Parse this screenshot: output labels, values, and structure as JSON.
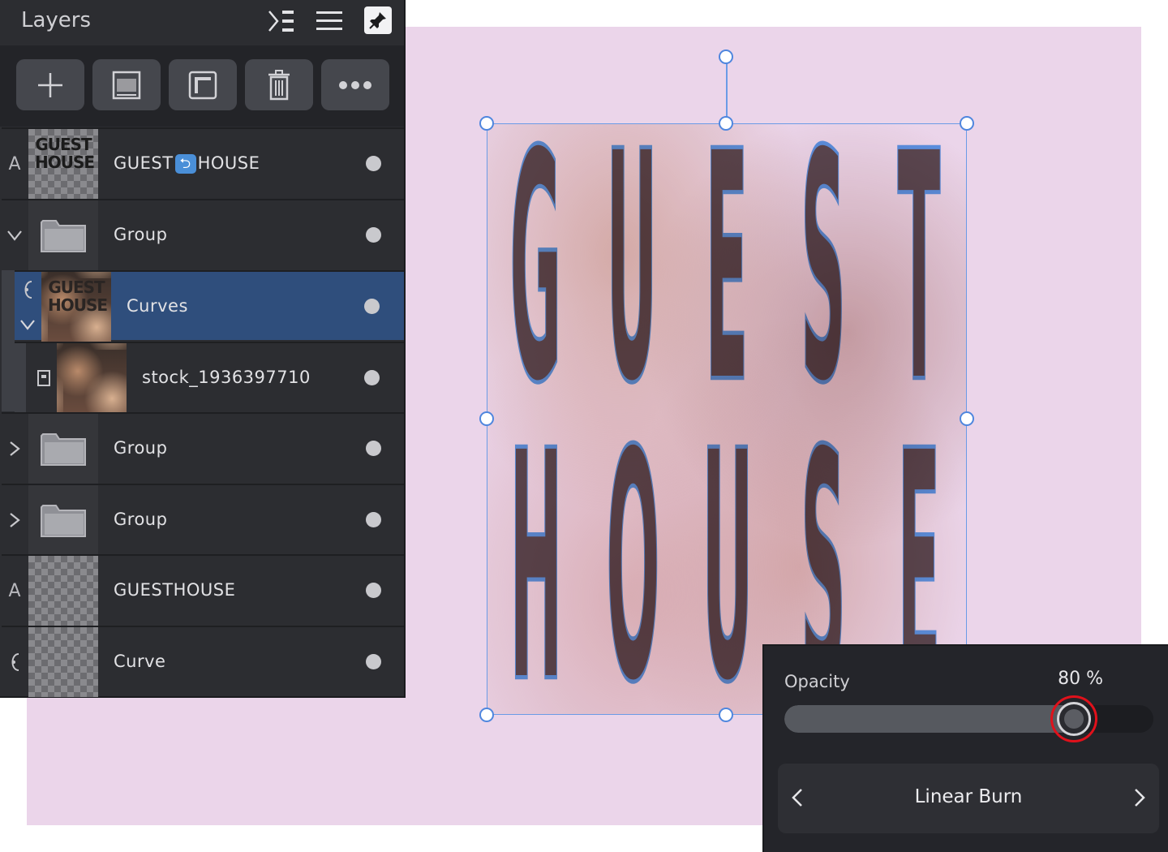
{
  "panel": {
    "title": "Layers"
  },
  "layers": [
    {
      "tag": "A",
      "label_a": "GUEST",
      "label_b": "HOUSE",
      "thumb_text": "GUEST HOUSE",
      "link_glyph": "⮌"
    },
    {
      "tag": "⌄",
      "label": "Group"
    },
    {
      "tag": "⌇",
      "tag2": "⌄",
      "label": "Curves",
      "thumb_text": "GUEST HOUSE"
    },
    {
      "label": "stock_1936397710"
    },
    {
      "tag": "›",
      "label": "Group"
    },
    {
      "tag": "›",
      "label": "Group"
    },
    {
      "tag": "A",
      "label": "GUESTHOUSE"
    },
    {
      "tag": "⌇",
      "label": "Curve"
    }
  ],
  "artwork": {
    "line1": [
      "G",
      "U",
      "E",
      "S",
      "T"
    ],
    "line2": [
      "H",
      "O",
      "U",
      "S",
      "E"
    ]
  },
  "opacity": {
    "label": "Opacity",
    "value_text": "80 %",
    "value": 80
  },
  "blend_mode": {
    "label": "Linear Burn",
    "prev_glyph": "‹",
    "next_glyph": "›"
  },
  "colors": {
    "canvas_bg": "#ebd5ea",
    "panel_bg": "#2c2d31",
    "selected_row": "#2f4e7c",
    "selection_stroke": "#6b9be6",
    "highlight_ring": "#e0111b"
  }
}
